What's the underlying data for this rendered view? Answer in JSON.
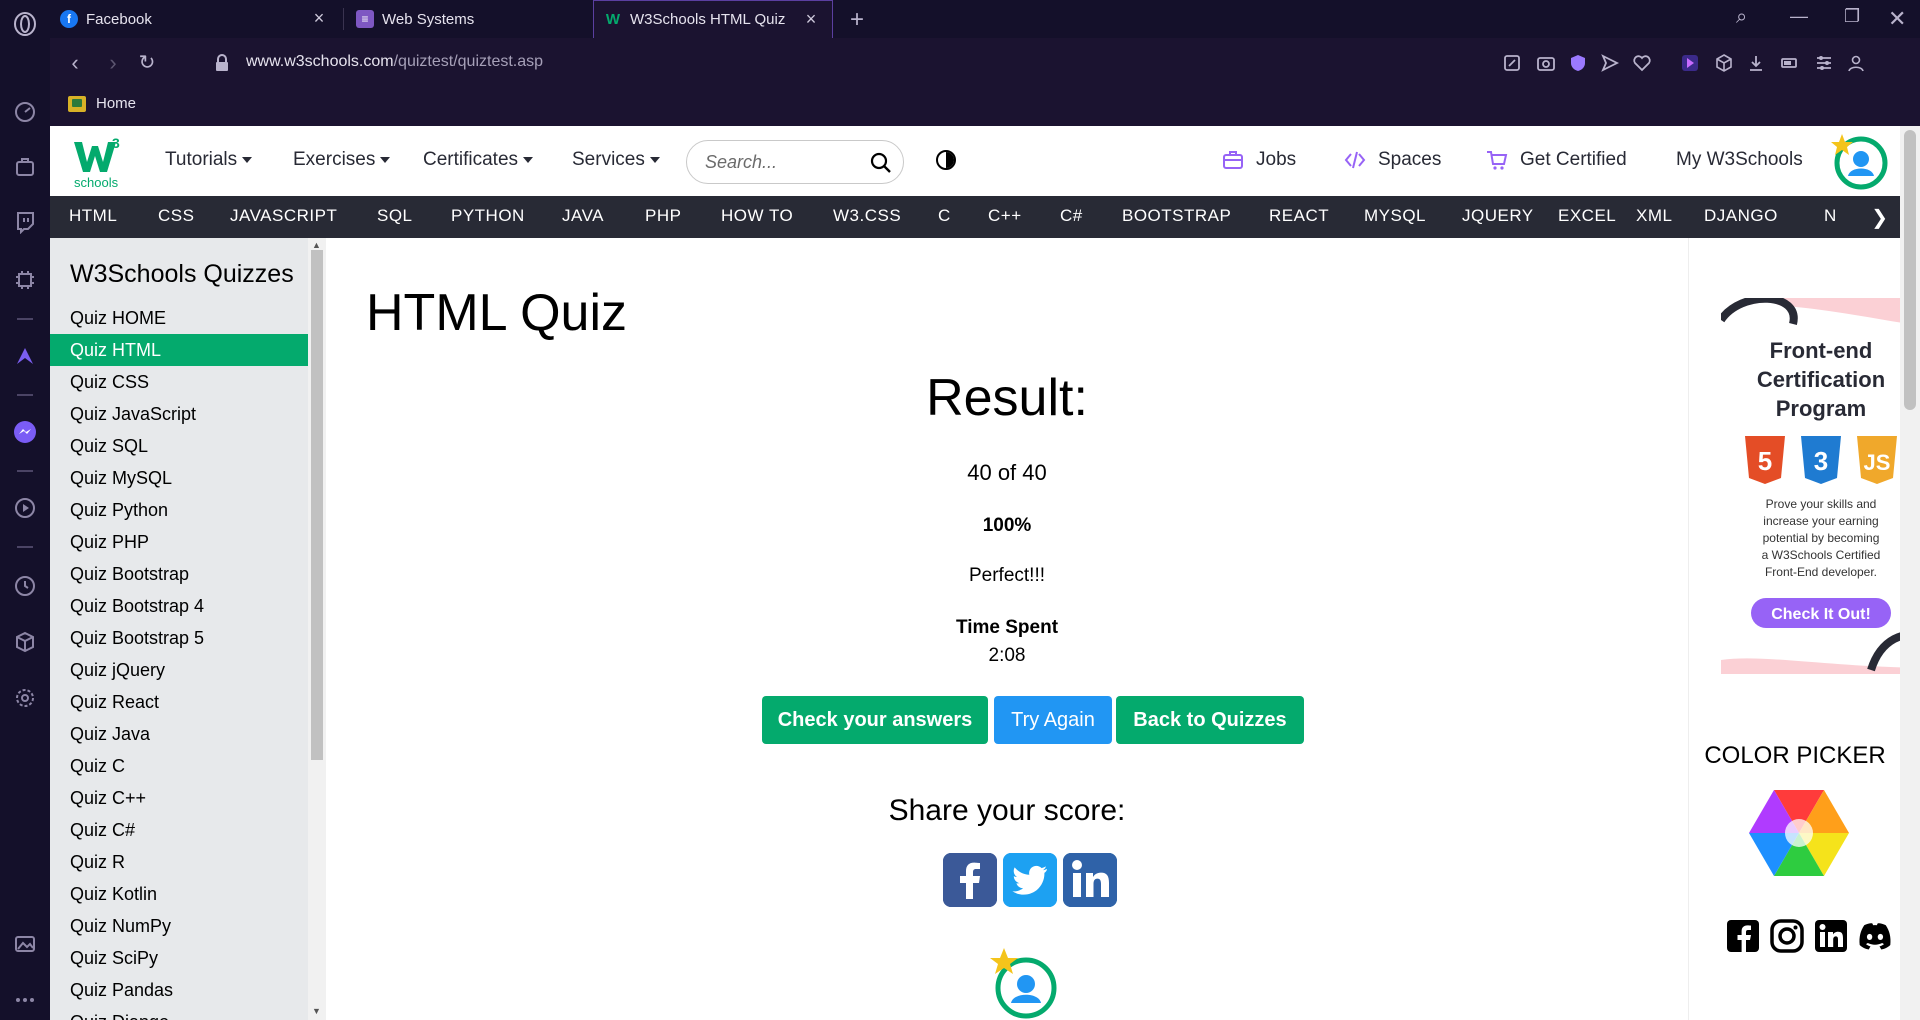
{
  "browser": {
    "tabs": [
      {
        "title": "Facebook",
        "icon": "facebook-icon"
      },
      {
        "title": "Web Systems",
        "icon": "list-icon"
      },
      {
        "title": "W3Schools HTML Quiz",
        "icon": "w3schools-icon",
        "active": true
      }
    ],
    "url_host": "www.w3schools.com",
    "url_path": "/quiztest/quiztest.asp",
    "bookmarks": [
      {
        "label": "Home"
      }
    ]
  },
  "topnav": {
    "menus": [
      "Tutorials",
      "Exercises",
      "Certificates",
      "Services"
    ],
    "search_placeholder": "Search...",
    "right_links": [
      "Jobs",
      "Spaces",
      "Get Certified",
      "My W3Schools"
    ]
  },
  "subjects": [
    "HTML",
    "CSS",
    "JAVASCRIPT",
    "SQL",
    "PYTHON",
    "JAVA",
    "PHP",
    "HOW TO",
    "W3.CSS",
    "C",
    "C++",
    "C#",
    "BOOTSTRAP",
    "REACT",
    "MYSQL",
    "JQUERY",
    "EXCEL",
    "XML",
    "DJANGO",
    "N"
  ],
  "sidebar": {
    "heading": "W3Schools Quizzes",
    "items": [
      "Quiz HOME",
      "Quiz HTML",
      "Quiz CSS",
      "Quiz JavaScript",
      "Quiz SQL",
      "Quiz MySQL",
      "Quiz Python",
      "Quiz PHP",
      "Quiz Bootstrap",
      "Quiz Bootstrap 4",
      "Quiz Bootstrap 5",
      "Quiz jQuery",
      "Quiz React",
      "Quiz Java",
      "Quiz C",
      "Quiz C++",
      "Quiz C#",
      "Quiz R",
      "Quiz Kotlin",
      "Quiz NumPy",
      "Quiz SciPy",
      "Quiz Pandas",
      "Quiz Django"
    ],
    "active_index": 1
  },
  "main": {
    "title": "HTML Quiz",
    "result_heading": "Result:",
    "score": "40 of 40",
    "percent": "100%",
    "verdict": "Perfect!!!",
    "time_label": "Time Spent",
    "time_value": "2:08",
    "buttons": {
      "check": "Check your answers",
      "try": "Try Again",
      "back": "Back to Quizzes"
    },
    "share_heading": "Share your score:"
  },
  "right": {
    "ad": {
      "title_lines": [
        "Front-end",
        "Certification",
        "Program"
      ],
      "body_lines": [
        "Prove your skills and",
        "increase your earning",
        "potential by becoming",
        "a W3Schools Certified",
        "Front-End developer."
      ],
      "cta": "Check It Out!"
    },
    "color_picker": "COLOR PICKER"
  },
  "colors": {
    "green": "#04aa6d",
    "blue": "#2196f3",
    "dark_nav": "#282a35",
    "sidebar_bg": "#e7e9eb",
    "purple": "#9763f6"
  }
}
